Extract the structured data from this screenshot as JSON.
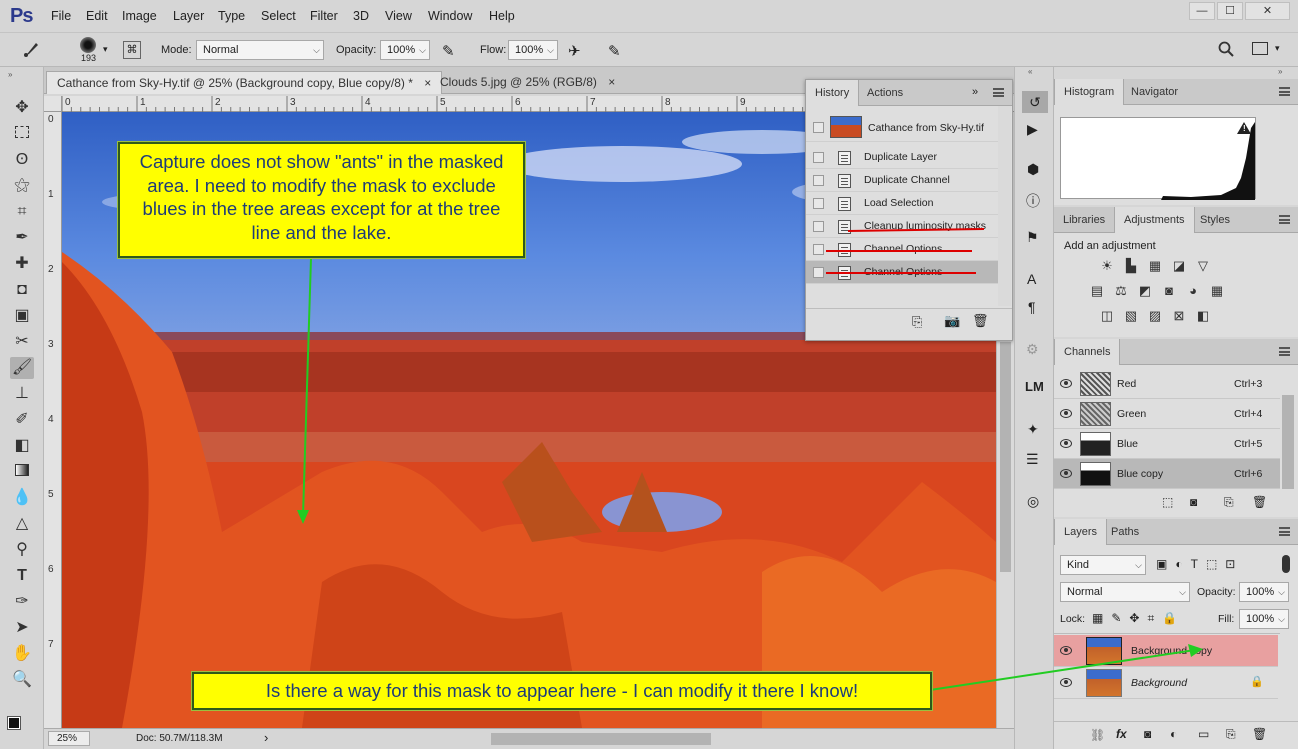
{
  "app": {
    "logo": "Ps"
  },
  "menu": [
    "File",
    "Edit",
    "Image",
    "Layer",
    "Type",
    "Select",
    "Filter",
    "3D",
    "View",
    "Window",
    "Help"
  ],
  "window_controls": {
    "minimize": "—",
    "maximize": "☐",
    "close": "✕"
  },
  "options": {
    "brush_size": "193",
    "mode_label": "Mode:",
    "mode_value": "Normal",
    "opacity_label": "Opacity:",
    "opacity_value": "100%",
    "flow_label": "Flow:",
    "flow_value": "100%"
  },
  "tabs": [
    {
      "label": "Cathance from Sky-Hy.tif @ 25% (Background copy, Blue copy/8) *",
      "close": "×",
      "active": true
    },
    {
      "label": "Clouds 5.jpg @ 25% (RGB/8)",
      "close": "×",
      "active": false
    }
  ],
  "ruler_top": [
    "0",
    "1",
    "2",
    "3",
    "4",
    "5",
    "6",
    "7",
    "8",
    "9"
  ],
  "ruler_left": [
    "0",
    "1",
    "2",
    "3",
    "4",
    "5",
    "6",
    "7"
  ],
  "status": {
    "zoom": "25%",
    "doc": "Doc: 50.7M/118.3M",
    "arrow": "›"
  },
  "history": {
    "tabs": [
      "History",
      "Actions"
    ],
    "snapshot": "Cathance from Sky-Hy.tif",
    "items": [
      "Duplicate Layer",
      "Duplicate Channel",
      "Load Selection",
      "Cleanup luminosity masks",
      "Channel Options",
      "Channel Options"
    ]
  },
  "histogram": {
    "tabs": [
      "Histogram",
      "Navigator"
    ],
    "warning": "!"
  },
  "adjustments": {
    "tabs": [
      "Libraries",
      "Adjustments",
      "Styles"
    ],
    "add_label": "Add an adjustment"
  },
  "channels": {
    "tab": "Channels",
    "rows": [
      {
        "name": "Red",
        "shortcut": "Ctrl+3"
      },
      {
        "name": "Green",
        "shortcut": "Ctrl+4"
      },
      {
        "name": "Blue",
        "shortcut": "Ctrl+5"
      },
      {
        "name": "Blue copy",
        "shortcut": "Ctrl+6"
      }
    ]
  },
  "layers": {
    "tabs": [
      "Layers",
      "Paths"
    ],
    "kind": "Kind",
    "blend": "Normal",
    "opacity_label": "Opacity:",
    "opacity_value": "100%",
    "lock_label": "Lock:",
    "fill_label": "Fill:",
    "fill_value": "100%",
    "rows": [
      {
        "name": "Background copy",
        "selected": true
      },
      {
        "name": "Background",
        "selected": false
      }
    ]
  },
  "annotations": {
    "callout1": "Capture does not show \"ants\" in the masked area. I need to modify the mask to exclude blues in the tree areas except for at the tree line and the lake.",
    "callout2": "Is there a way for this mask to appear here - I can modify it there I know!"
  },
  "colors": {
    "callout_bg": "#ffff00",
    "callout_text": "#1e3c78",
    "arrow": "#22cc22",
    "strike": "#dd0000",
    "selected_layer": "#e8a0a0"
  }
}
